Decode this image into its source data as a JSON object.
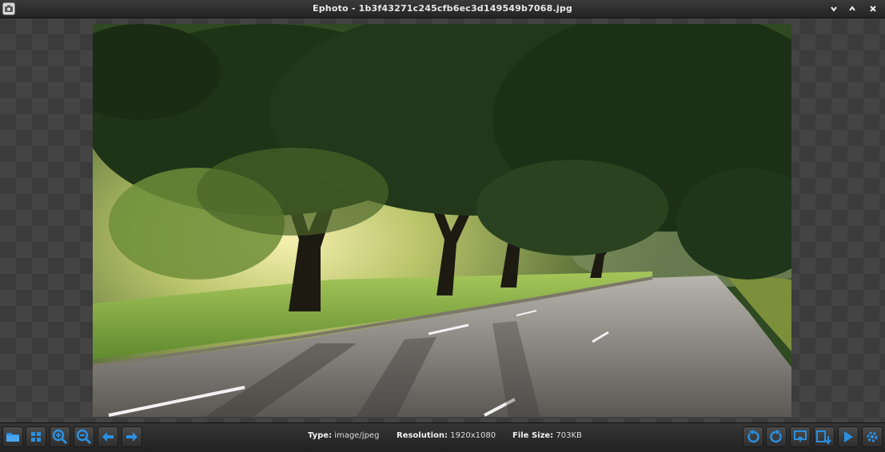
{
  "window": {
    "title": "Ephoto - 1b3f43271c245cfb6ec3d149549b7068.jpg",
    "app_icon": "camera-icon",
    "controls": [
      "minimize-icon",
      "maximize-icon",
      "close-icon"
    ]
  },
  "image": {
    "description_icon": "photo",
    "scene": "tree-lined road at sunrise"
  },
  "toolbar": {
    "left_buttons": [
      "folder-icon",
      "grid-icon",
      "zoom-in-icon",
      "zoom-out-icon",
      "previous-icon",
      "next-icon"
    ],
    "right_buttons": [
      "rotate-left-icon",
      "rotate-right-icon",
      "set-wallpaper-icon",
      "save-icon",
      "slideshow-icon",
      "settings-icon"
    ],
    "info": {
      "type_label": "Type:",
      "type_value": "image/jpeg",
      "resolution_label": "Resolution:",
      "resolution_value": "1920x1080",
      "filesize_label": "File Size:",
      "filesize_value": "703KB"
    }
  },
  "colors": {
    "accent": "#2a8fe0",
    "background": "#2b2b2b"
  }
}
